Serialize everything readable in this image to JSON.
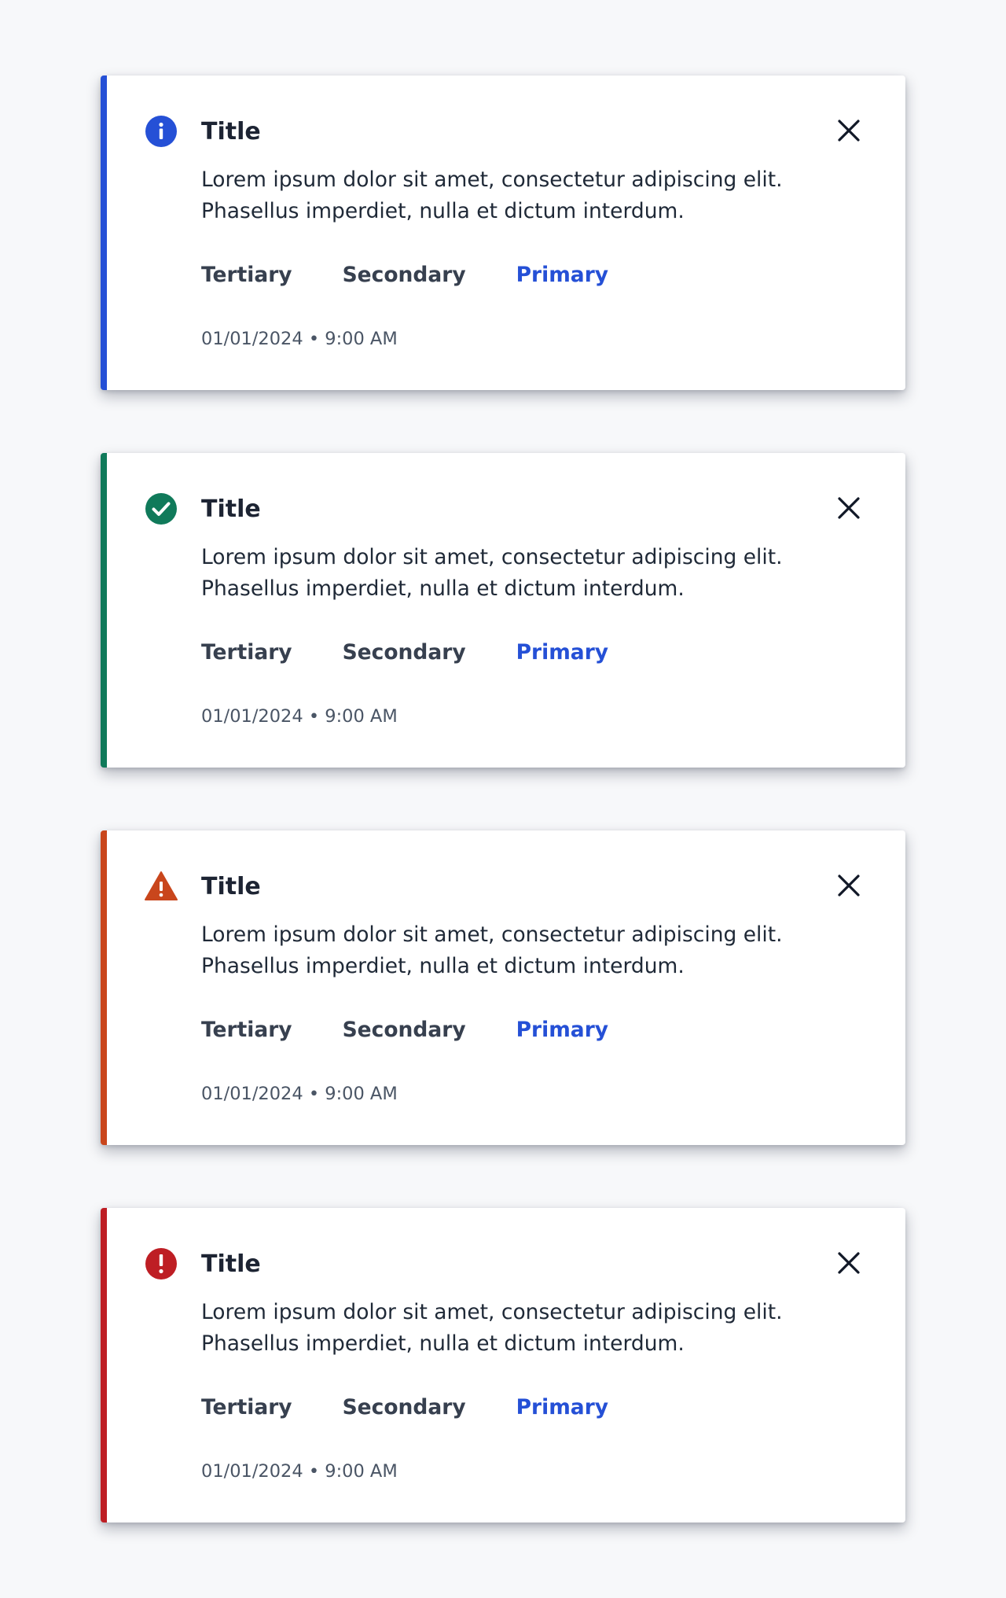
{
  "toasts": [
    {
      "variant": "info",
      "icon": "info-icon",
      "accent_color": "#2550d6",
      "title": "Title",
      "message": "Lorem ipsum dolor sit amet, consectetur adipiscing elit. Phasellus imperdiet, nulla et dictum interdum.",
      "actions": [
        "Tertiary",
        "Secondary",
        "Primary"
      ],
      "timestamp": "01/01/2024 • 9:00 AM",
      "close_icon": "close-icon"
    },
    {
      "variant": "success",
      "icon": "check-circle-icon",
      "accent_color": "#107a5a",
      "title": "Title",
      "message": "Lorem ipsum dolor sit amet, consectetur adipiscing elit. Phasellus imperdiet, nulla et dictum interdum.",
      "actions": [
        "Tertiary",
        "Secondary",
        "Primary"
      ],
      "timestamp": "01/01/2024 • 9:00 AM",
      "close_icon": "close-icon"
    },
    {
      "variant": "warning",
      "icon": "warning-triangle-icon",
      "accent_color": "#c9461c",
      "title": "Title",
      "message": "Lorem ipsum dolor sit amet, consectetur adipiscing elit. Phasellus imperdiet, nulla et dictum interdum.",
      "actions": [
        "Tertiary",
        "Secondary",
        "Primary"
      ],
      "timestamp": "01/01/2024 • 9:00 AM",
      "close_icon": "close-icon"
    },
    {
      "variant": "error",
      "icon": "error-icon",
      "accent_color": "#be1e24",
      "title": "Title",
      "message": "Lorem ipsum dolor sit amet, consectetur adipiscing elit. Phasellus imperdiet, nulla et dictum interdum.",
      "actions": [
        "Tertiary",
        "Secondary",
        "Primary"
      ],
      "timestamp": "01/01/2024 • 9:00 AM",
      "close_icon": "close-icon"
    }
  ],
  "colors": {
    "page_background": "#f7f8fa",
    "card_background": "#ffffff",
    "primary_action": "#2550d6",
    "action_text": "#37404f",
    "title_text": "#1d2433",
    "timestamp_text": "#4a5565"
  }
}
